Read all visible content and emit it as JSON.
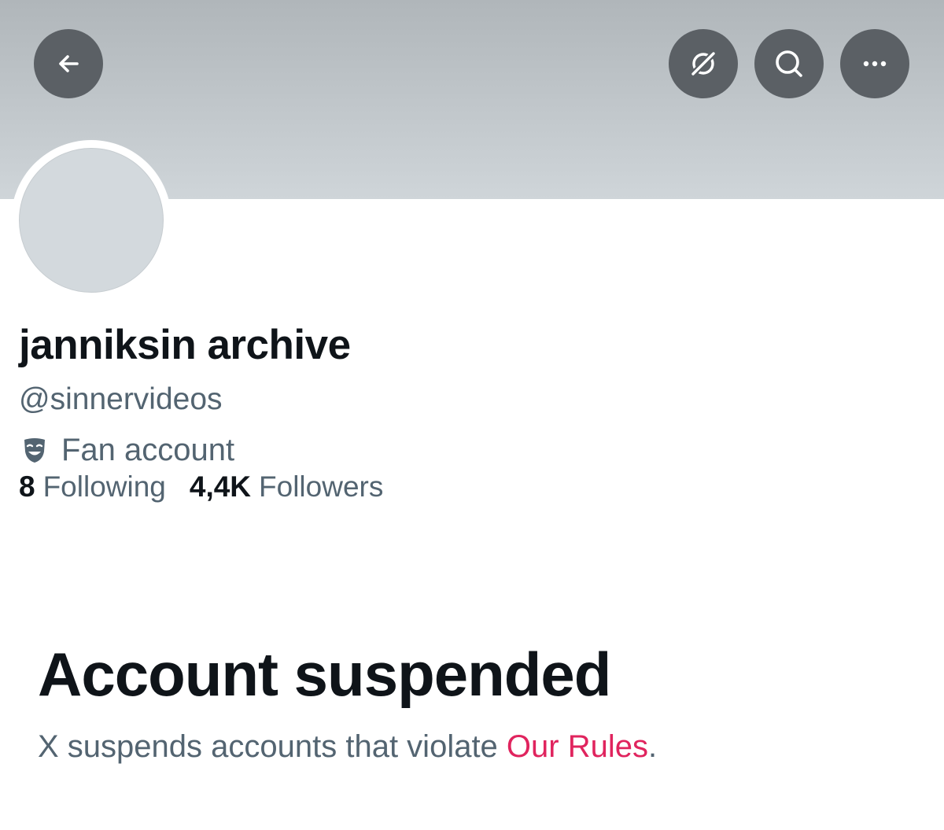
{
  "profile": {
    "display_name": "janniksin archive",
    "handle": "@sinnervideos",
    "category": "Fan account",
    "category_icon": "theater-mask-icon",
    "following_count": "8",
    "following_label": "Following",
    "followers_count": "4,4K",
    "followers_label": "Followers"
  },
  "header": {
    "back_icon": "arrow-left-icon",
    "translate_icon": "translate-globe-icon",
    "search_icon": "search-icon",
    "more_icon": "more-horizontal-icon"
  },
  "suspension": {
    "title": "Account suspended",
    "text_prefix": "X suspends accounts that violate ",
    "link_text": "Our Rules",
    "text_suffix": "."
  },
  "colors": {
    "banner": "#c1c7cb",
    "header_button": "#5b6065",
    "primary_text": "#0f1419",
    "secondary_text": "#536471",
    "link": "#e0245e",
    "avatar_placeholder": "#d3d9dd"
  }
}
